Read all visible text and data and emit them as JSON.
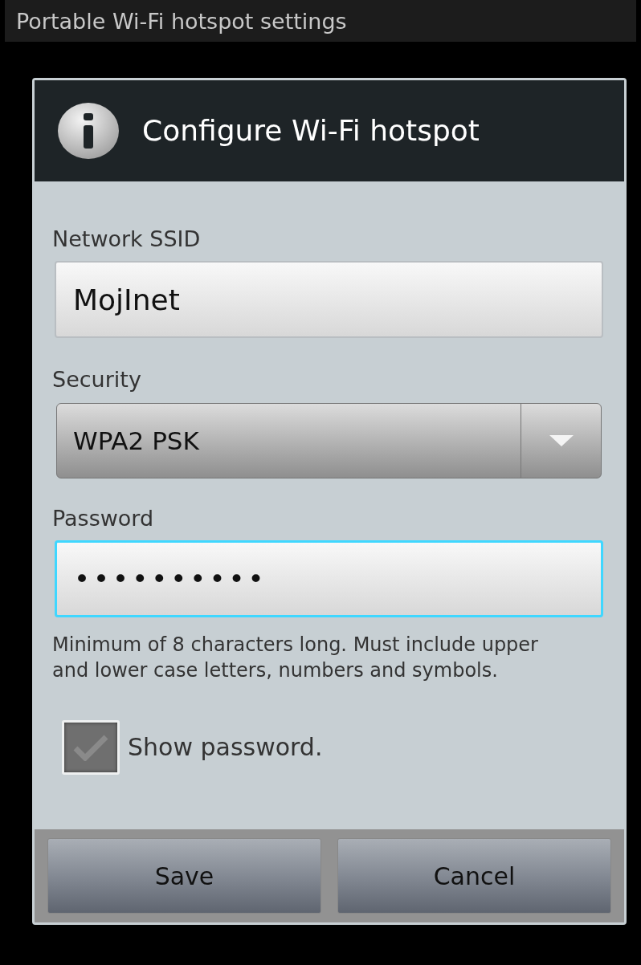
{
  "window": {
    "title": "Portable Wi-Fi hotspot settings"
  },
  "dialog": {
    "title": "Configure Wi-Fi hotspot",
    "ssid": {
      "label": "Network SSID",
      "value": "MojInet"
    },
    "security": {
      "label": "Security",
      "value": "WPA2 PSK"
    },
    "password": {
      "label": "Password",
      "value": "••••••••••",
      "focused": true
    },
    "hint": "Minimum of 8 characters long. Must include upper and lower case letters, numbers and symbols.",
    "show_password": {
      "label": "Show password.",
      "checked": false
    },
    "buttons": [
      "Save",
      "Cancel"
    ]
  }
}
